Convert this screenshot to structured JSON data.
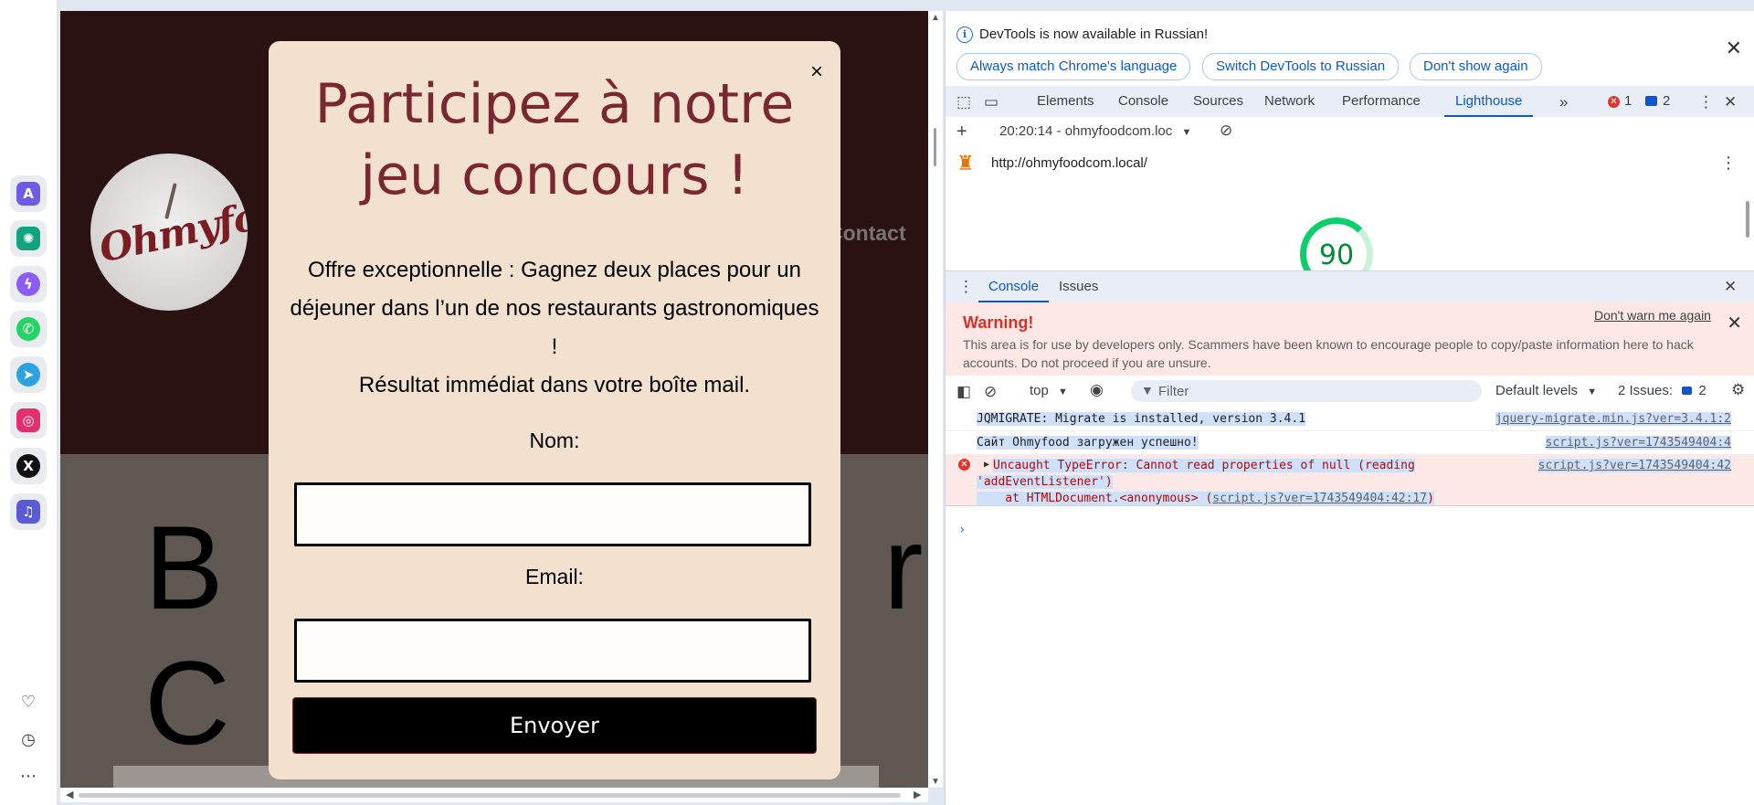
{
  "rail": {
    "apps": [
      {
        "icon": "aria-icon",
        "glyph": "A",
        "color": "#6d5ce8"
      },
      {
        "icon": "chatgpt-icon",
        "glyph": "✺",
        "color": "#10a37f"
      },
      {
        "icon": "messenger-icon",
        "glyph": "ϟ",
        "color": "#8b5cf6"
      },
      {
        "icon": "whatsapp-icon",
        "glyph": "✆",
        "color": "#25d366"
      },
      {
        "icon": "telegram-icon",
        "glyph": "➤",
        "color": "#2aa3e0"
      },
      {
        "icon": "instagram-icon",
        "glyph": "◎",
        "color": "#e1306c"
      },
      {
        "icon": "x-icon",
        "glyph": "X",
        "color": "#111111"
      },
      {
        "icon": "music-icon",
        "glyph": "♫",
        "color": "#5b5bd6"
      }
    ]
  },
  "site": {
    "logo_text": "Ohmyfood",
    "nav": {
      "item_partial": "nt",
      "contact": "Contact"
    },
    "hero_line1": "B                    r",
    "hero_line2": "C"
  },
  "modal": {
    "close_glyph": "×",
    "title": "Participez à notre jeu concours !",
    "offer": "Offre exceptionnelle : Gagnez deux places pour un déjeuner dans l’un de nos restaurants gastronomiques !",
    "result": "Résultat immédiat dans votre boîte mail.",
    "name_label": "Nom:",
    "email_label": "Email:",
    "name_value": "",
    "email_value": "",
    "submit_label": "Envoyer"
  },
  "devtools": {
    "lang_banner": {
      "text": "DevTools is now available in Russian!",
      "btn_match": "Always match Chrome's language",
      "btn_switch": "Switch DevTools to Russian",
      "btn_dont_show": "Don't show again"
    },
    "tabs": [
      "Elements",
      "Console",
      "Sources",
      "Network",
      "Performance",
      "Lighthouse"
    ],
    "active_tab": "Lighthouse",
    "error_count": "1",
    "message_count": "2",
    "lighthouse": {
      "report_select": "20:20:14 - ohmyfoodcom.loc",
      "url": "http://ohmyfoodcom.local/",
      "score": "90"
    },
    "drawer_tabs": [
      "Console",
      "Issues"
    ],
    "warning": {
      "title": "Warning!",
      "dismiss": "Don't warn me again",
      "text": "This area is for use by developers only. Scammers have been known to encourage people to copy/paste information here to hack accounts. Do not proceed if you are unsure."
    },
    "console_toolbar": {
      "context": "top",
      "filter_placeholder": "Filter",
      "levels": "Default levels",
      "issues": "2 Issues:",
      "issues_count": "2"
    },
    "logs": [
      {
        "text": "JQMIGRATE: Migrate is installed, version 3.4.1",
        "source": "jquery-migrate.min.js?ver=3.4.1:2"
      },
      {
        "text": "Сайт Ohmyfood загружен успешно!",
        "source": "script.js?ver=1743549404:4"
      },
      {
        "text_line1": "Uncaught TypeError: Cannot read properties of null (reading",
        "text_line2": "'addEventListener')",
        "text_line3": "    at HTMLDocument.<anonymous> (",
        "stack_link": "script.js?ver=1743549404:42:17",
        "stack_close": ")",
        "source": "script.js?ver=1743549404:42"
      }
    ]
  }
}
